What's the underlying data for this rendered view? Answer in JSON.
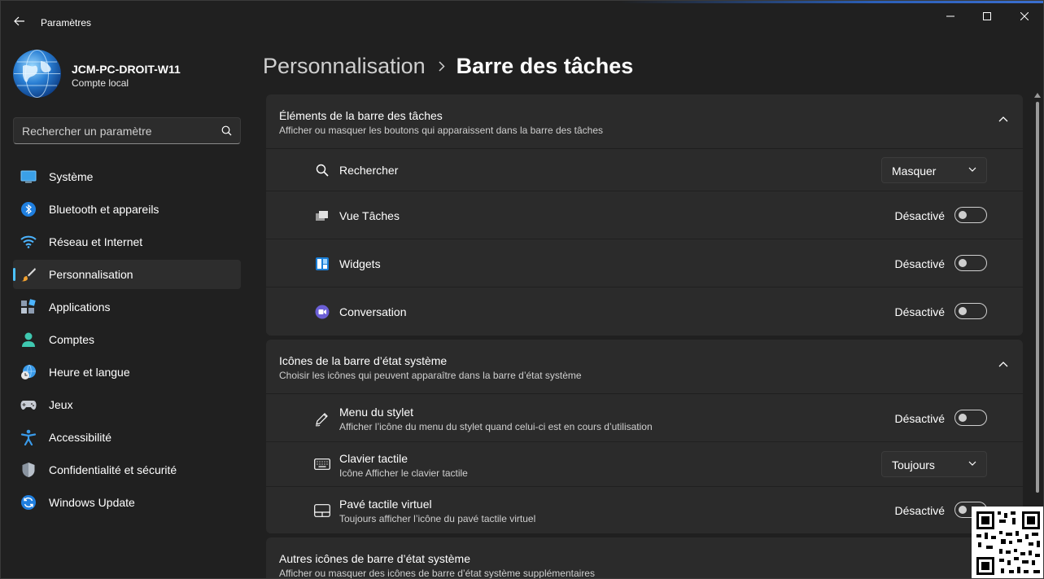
{
  "window": {
    "title": "Paramètres",
    "controls": {
      "minimize": "minimize-icon",
      "maximize": "maximize-icon",
      "close": "close-icon"
    }
  },
  "profile": {
    "name": "JCM-PC-DROIT-W11",
    "account_type": "Compte local"
  },
  "search": {
    "placeholder": "Rechercher un paramètre"
  },
  "sidebar": {
    "items": [
      {
        "label": "Système",
        "icon": "display-icon",
        "active": false
      },
      {
        "label": "Bluetooth et appareils",
        "icon": "bluetooth-icon",
        "active": false
      },
      {
        "label": "Réseau et Internet",
        "icon": "wifi-icon",
        "active": false
      },
      {
        "label": "Personnalisation",
        "icon": "brush-icon",
        "active": true
      },
      {
        "label": "Applications",
        "icon": "apps-icon",
        "active": false
      },
      {
        "label": "Comptes",
        "icon": "person-icon",
        "active": false
      },
      {
        "label": "Heure et langue",
        "icon": "globe-clock-icon",
        "active": false
      },
      {
        "label": "Jeux",
        "icon": "gamepad-icon",
        "active": false
      },
      {
        "label": "Accessibilité",
        "icon": "accessibility-icon",
        "active": false
      },
      {
        "label": "Confidentialité et sécurité",
        "icon": "shield-icon",
        "active": false
      },
      {
        "label": "Windows Update",
        "icon": "update-icon",
        "active": false
      }
    ]
  },
  "breadcrumb": {
    "parent": "Personnalisation",
    "current": "Barre des tâches"
  },
  "sections": {
    "taskbar_items": {
      "title": "Éléments de la barre des tâches",
      "subtitle": "Afficher ou masquer les boutons qui apparaissent dans la barre des tâches",
      "rows": {
        "search": {
          "label": "Rechercher",
          "value": "Masquer"
        },
        "task_view": {
          "label": "Vue Tâches",
          "state": "Désactivé"
        },
        "widgets": {
          "label": "Widgets",
          "state": "Désactivé"
        },
        "chat": {
          "label": "Conversation",
          "state": "Désactivé"
        }
      }
    },
    "tray_icons": {
      "title": "Icônes de la barre d’état système",
      "subtitle": "Choisir les icônes qui peuvent apparaître dans la barre d’état système",
      "rows": {
        "pen": {
          "label": "Menu du stylet",
          "description": "Afficher l’icône du menu du stylet quand celui-ci est en cours d’utilisation",
          "state": "Désactivé"
        },
        "keyboard": {
          "label": "Clavier tactile",
          "description": "Icône Afficher le clavier tactile",
          "value": "Toujours"
        },
        "touchpad": {
          "label": "Pavé tactile virtuel",
          "description": "Toujours afficher l’icône du pavé tactile virtuel",
          "state": "Désactivé"
        }
      }
    },
    "other_tray": {
      "title": "Autres icônes de barre d’état système",
      "subtitle": "Afficher ou masquer des icônes de barre d’état système supplémentaires"
    }
  },
  "colors": {
    "background": "#202020",
    "card": "#2b2b2b",
    "accent": "#4cc2ff"
  }
}
